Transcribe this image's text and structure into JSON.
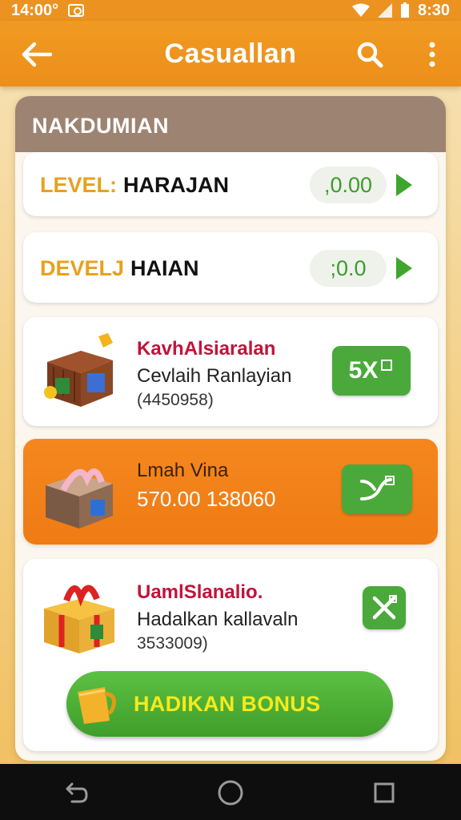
{
  "status_bar": {
    "time_left": "14:00°",
    "time_right": "8:30"
  },
  "app_bar": {
    "title": "Casuallan",
    "back_icon": "arrow-left-icon",
    "search_icon": "search-icon",
    "more_icon": "more-vert-icon"
  },
  "panel": {
    "header": "NAKDUMIAN",
    "levels": [
      {
        "label": "LEVEL:",
        "name": "HARAJAN",
        "value": ",0.00"
      },
      {
        "label": "DEVELJ",
        "name": "HAIAN",
        "value": ";0.0"
      }
    ],
    "rewards": [
      {
        "title": "KavhAlsiaralan",
        "subtitle": "Cevlaih Ranlayian",
        "number": "(4450958)",
        "button": "5X"
      },
      {
        "title": "Lmah Vina",
        "subtitle": "570.00 138060",
        "number": "",
        "button": ""
      },
      {
        "title": "UamlSlanalio.",
        "subtitle": "Hadalkan kallavaln",
        "number": "3533009)",
        "button": ""
      }
    ],
    "bonus_button": "HADIKAN BONUS"
  },
  "colors": {
    "accent": "#ec8f1a",
    "green": "#4aa93a",
    "header_brown": "#9d8371",
    "title_red": "#c2123a"
  }
}
